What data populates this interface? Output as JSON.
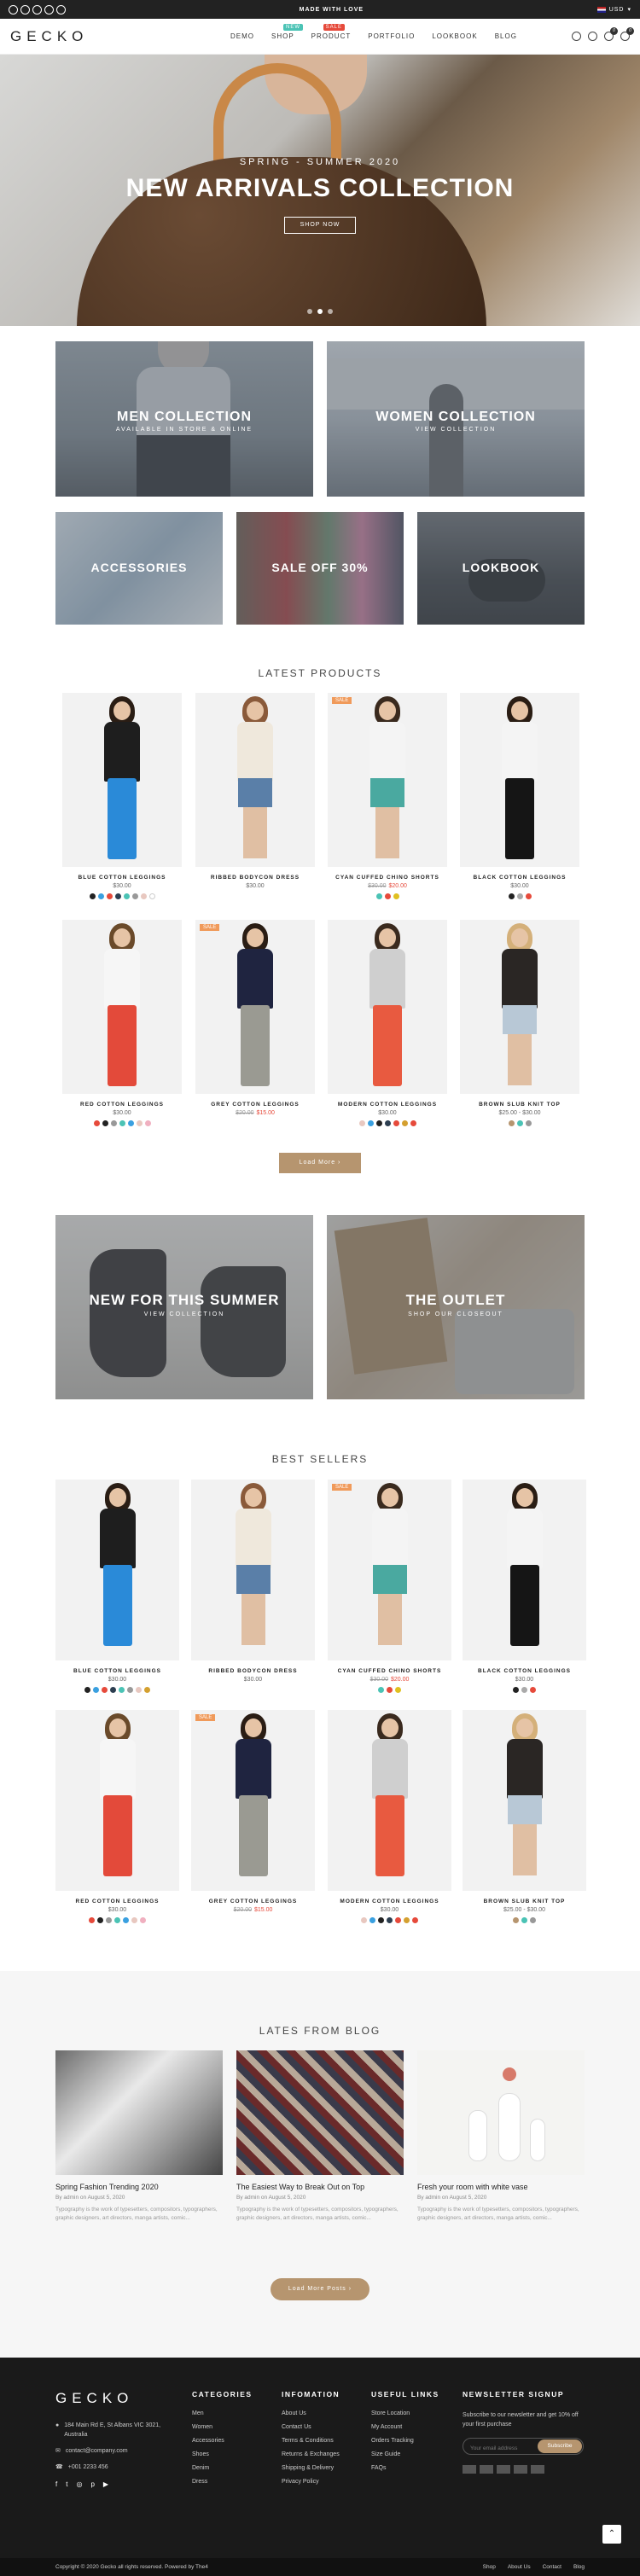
{
  "topbar": {
    "message": "MADE WITH LOVE",
    "currency": "USD"
  },
  "header": {
    "logo": "GECKO",
    "nav": [
      {
        "label": "DEMO",
        "badge": ""
      },
      {
        "label": "SHOP",
        "badge": "NEW"
      },
      {
        "label": "PRODUCT",
        "badge": "SALE"
      },
      {
        "label": "PORTFOLIO",
        "badge": ""
      },
      {
        "label": "LOOKBOOK",
        "badge": ""
      },
      {
        "label": "BLOG",
        "badge": ""
      }
    ],
    "cart_count": "0",
    "wishlist_count": "0"
  },
  "hero": {
    "subtitle": "SPRING - SUMMER 2020",
    "title": "NEW ARRIVALS COLLECTION",
    "button": "SHOP NOW"
  },
  "collections": [
    {
      "title": "MEN COLLECTION",
      "subtitle": "AVAILABLE IN STORE & ONLINE"
    },
    {
      "title": "WOMEN COLLECTION",
      "subtitle": "VIEW COLLECTION"
    },
    {
      "title": "ACCESSORIES",
      "subtitle": ""
    },
    {
      "title": "SALE OFF 30%",
      "subtitle": ""
    },
    {
      "title": "LOOKBOOK",
      "subtitle": ""
    }
  ],
  "latest": {
    "title": "LATEST PRODUCTS",
    "load_more": "Load More",
    "products": [
      {
        "name": "BLUE COTTON LEGGINGS",
        "price": "$30.00",
        "old": "",
        "tag": "",
        "colors": [
          "#222222",
          "#3aa0e0",
          "#e64a3b",
          "#2c3e50",
          "#4bc3b5",
          "#999999",
          "#e8c8c0",
          "#ffffff"
        ]
      },
      {
        "name": "RIBBED BODYCON DRESS",
        "price": "$30.00",
        "old": "",
        "tag": "",
        "colors": []
      },
      {
        "name": "CYAN CUFFED CHINO SHORTS",
        "price": "$20.00",
        "old": "$30.00",
        "tag": "SALE",
        "colors": [
          "#4bc3b5",
          "#e64a3b",
          "#e0c020"
        ]
      },
      {
        "name": "BLACK COTTON LEGGINGS",
        "price": "$30.00",
        "old": "",
        "tag": "",
        "colors": [
          "#222222",
          "#aaaaaa",
          "#e64a3b"
        ]
      },
      {
        "name": "RED COTTON LEGGINGS",
        "price": "$30.00",
        "old": "",
        "tag": "",
        "colors": [
          "#e64a3b",
          "#222222",
          "#999999",
          "#4bc3b5",
          "#3aa0e0",
          "#e8c8c0",
          "#f0b0c0"
        ]
      },
      {
        "name": "GREY COTTON LEGGINGS",
        "price": "$15.00",
        "old": "$20.00",
        "tag": "SALE",
        "colors": []
      },
      {
        "name": "MODERN COTTON LEGGINGS",
        "price": "$30.00",
        "old": "",
        "tag": "",
        "colors": [
          "#e8c8c0",
          "#3aa0e0",
          "#222222",
          "#2c3e50",
          "#e64a3b",
          "#d4a030",
          "#e64a3b"
        ]
      },
      {
        "name": "BROWN SLUB KNIT TOP",
        "price": "$25.00 - $30.00",
        "old": "",
        "tag": "",
        "colors": [
          "#b6956f",
          "#4bc3b5",
          "#999999"
        ]
      }
    ]
  },
  "promos": [
    {
      "title": "NEW FOR THIS SUMMER",
      "subtitle": "VIEW COLLECTION"
    },
    {
      "title": "THE OUTLET",
      "subtitle": "SHOP OUR CLOSEOUT"
    }
  ],
  "bestsellers": {
    "title": "BEST SELLERS",
    "products": [
      {
        "name": "BLUE COTTON LEGGINGS",
        "price": "$30.00",
        "old": "",
        "tag": "",
        "colors": [
          "#222222",
          "#3aa0e0",
          "#e64a3b",
          "#2c3e50",
          "#4bc3b5",
          "#999999",
          "#e8c8c0",
          "#d4a030"
        ]
      },
      {
        "name": "RIBBED BODYCON DRESS",
        "price": "$30.00",
        "old": "",
        "tag": "",
        "colors": []
      },
      {
        "name": "CYAN CUFFED CHINO SHORTS",
        "price": "$20.00",
        "old": "$30.00",
        "tag": "SALE",
        "colors": [
          "#4bc3b5",
          "#e64a3b",
          "#e0c020"
        ]
      },
      {
        "name": "BLACK COTTON LEGGINGS",
        "price": "$30.00",
        "old": "",
        "tag": "",
        "colors": [
          "#222222",
          "#aaaaaa",
          "#e64a3b"
        ]
      },
      {
        "name": "RED COTTON LEGGINGS",
        "price": "$30.00",
        "old": "",
        "tag": "",
        "colors": [
          "#e64a3b",
          "#222222",
          "#999999",
          "#4bc3b5",
          "#3aa0e0",
          "#e8c8c0",
          "#f0b0c0"
        ]
      },
      {
        "name": "GREY COTTON LEGGINGS",
        "price": "$15.00",
        "old": "$20.00",
        "tag": "SALE",
        "colors": []
      },
      {
        "name": "MODERN COTTON LEGGINGS",
        "price": "$30.00",
        "old": "",
        "tag": "",
        "colors": [
          "#e8c8c0",
          "#3aa0e0",
          "#222222",
          "#2c3e50",
          "#e64a3b",
          "#d4a030",
          "#e64a3b"
        ]
      },
      {
        "name": "BROWN SLUB KNIT TOP",
        "price": "$25.00 - $30.00",
        "old": "",
        "tag": "",
        "colors": [
          "#b6956f",
          "#4bc3b5",
          "#999999"
        ]
      }
    ]
  },
  "blog": {
    "title": "LATES FROM BLOG",
    "load_more": "Load More Posts",
    "posts": [
      {
        "title": "Spring Fashion Trending 2020",
        "meta": "By admin on August 5, 2020",
        "excerpt": "Typography is the work of typesetters, compositors, typographers, graphic designers, art directors, manga artists, comic..."
      },
      {
        "title": "The Easiest Way to Break Out on Top",
        "meta": "By admin on August 5, 2020",
        "excerpt": "Typography is the work of typesetters, compositors, typographers, graphic designers, art directors, manga artists, comic..."
      },
      {
        "title": "Fresh your room with white vase",
        "meta": "By admin on August 5, 2020",
        "excerpt": "Typography is the work of typesetters, compositors, typographers, graphic designers, art directors, manga artists, comic..."
      }
    ]
  },
  "footer": {
    "logo": "GECKO",
    "address": "184 Main Rd E, St Albans VIC 3021, Australia",
    "email": "contact@company.com",
    "phone": "+001 2233 456",
    "categories_title": "CATEGORIES",
    "categories": [
      "Men",
      "Women",
      "Accessories",
      "Shoes",
      "Denim",
      "Dress"
    ],
    "info_title": "INFOMATION",
    "info": [
      "About Us",
      "Contact Us",
      "Terms & Conditions",
      "Returns & Exchanges",
      "Shipping & Delivery",
      "Privacy Policy"
    ],
    "useful_title": "USEFUL LINKS",
    "useful": [
      "Store Location",
      "My Account",
      "Orders Tracking",
      "Size Guide",
      "FAQs"
    ],
    "newsletter_title": "NEWSLETTER SIGNUP",
    "newsletter_text": "Subscribe to our newsletter and get 10% off your first purchase",
    "newsletter_placeholder": "Your email address",
    "subscribe": "Subscribe",
    "copyright": "Copyright © 2020 Gecko all rights reserved. Powered by The4",
    "bottom_links": [
      "Shop",
      "About Us",
      "Contact",
      "Blog"
    ]
  }
}
